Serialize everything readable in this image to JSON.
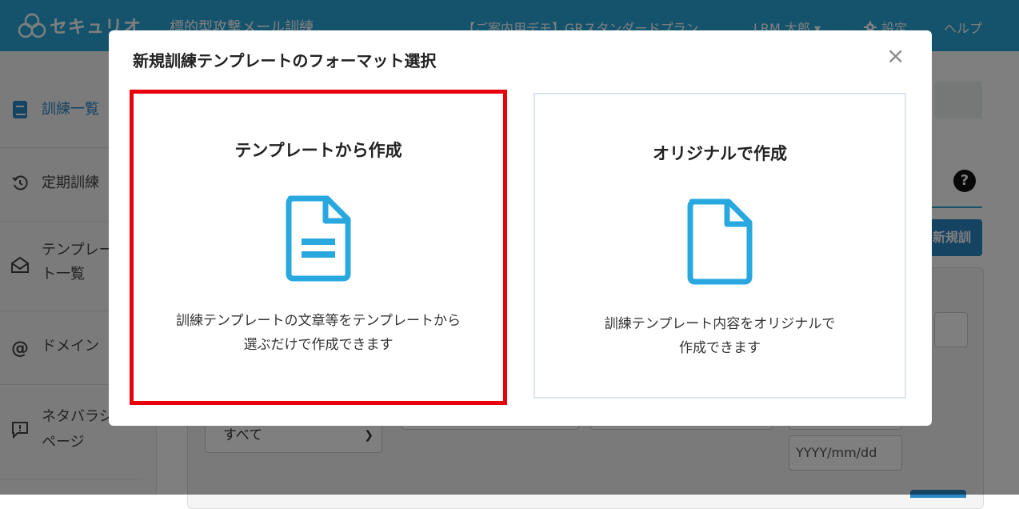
{
  "header": {
    "logo_text": "セキュリオ",
    "app_subtitle": "標的型攻撃メール訓練",
    "plan": "【ご案内用デモ】GRスタンダードプラン",
    "user": "LRM 太郎 ▾",
    "settings": "設定",
    "help": "ヘルプ"
  },
  "sidebar": {
    "items": [
      {
        "label": "訓練一覧",
        "icon": "book-icon"
      },
      {
        "label": "定期訓練",
        "icon": "history-icon"
      },
      {
        "label_l1": "テンプレー",
        "label_l2": "ト一覧",
        "icon": "mail-template-icon"
      },
      {
        "label": "ドメイン",
        "icon": "at-icon"
      },
      {
        "label_l1": "ネタバラシ",
        "label_l2": "ページ",
        "icon": "message-icon"
      }
    ]
  },
  "main": {
    "help_icon": "?",
    "new_button": "新規訓練",
    "filter_select": "すべて",
    "date_placeholder": "YYYY/mm/dd"
  },
  "modal": {
    "title": "新規訓練テンプレートのフォーマット選択",
    "close": "×",
    "cards": [
      {
        "title": "テンプレートから作成",
        "desc_l1": "訓練テンプレートの文章等をテンプレートから",
        "desc_l2": "選ぶだけで作成できます",
        "icon": "document-text-icon",
        "highlight_color": "#e8000b"
      },
      {
        "title": "オリジナルで作成",
        "desc_l1": "訓練テンプレート内容をオリジナルで",
        "desc_l2": "作成できます",
        "icon": "document-blank-icon"
      }
    ]
  },
  "colors": {
    "header_bg": "#2aa6d8",
    "icon_blue": "#29a8e0",
    "button_blue": "#2b86c5"
  }
}
